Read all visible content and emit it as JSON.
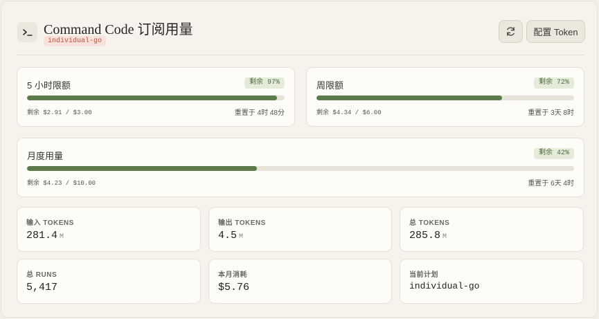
{
  "header": {
    "title": "Command Code 订阅用量",
    "plan_tag": "individual-go",
    "token_button": "配置 Token"
  },
  "quotas": [
    {
      "label": "5 小时限额",
      "remaining_badge": "剩余 97%",
      "remaining_percent": 97,
      "detail": "剩余 $2.91 / $3.00",
      "reset": "重置于 4时 48分"
    },
    {
      "label": "周限额",
      "remaining_badge": "剩余 72%",
      "remaining_percent": 72,
      "detail": "剩余 $4.34 / $6.00",
      "reset": "重置于 3天 8时"
    },
    {
      "label": "月度用量",
      "remaining_badge": "剩余 42%",
      "remaining_percent": 42,
      "detail": "剩余 $4.23 / $10.00",
      "reset": "重置于 6天 4时"
    }
  ],
  "stats": [
    {
      "label": "输入 TOKENS",
      "value": "281.4",
      "unit": "M"
    },
    {
      "label": "输出 TOKENS",
      "value": "4.5",
      "unit": "M"
    },
    {
      "label": "总 TOKENS",
      "value": "285.8",
      "unit": "M"
    },
    {
      "label": "总 RUNS",
      "value": "5,417",
      "unit": ""
    },
    {
      "label": "本月消耗",
      "value": "$5.76",
      "unit": ""
    },
    {
      "label": "当前计划",
      "value": "individual-go",
      "unit": ""
    }
  ],
  "colors": {
    "accent": "#5c7a4a",
    "badge_bg": "#e4ebd9",
    "plan_tag_text": "#c2503c"
  },
  "icons": {
    "logo": "terminal-prompt-icon",
    "refresh": "refresh-icon"
  }
}
